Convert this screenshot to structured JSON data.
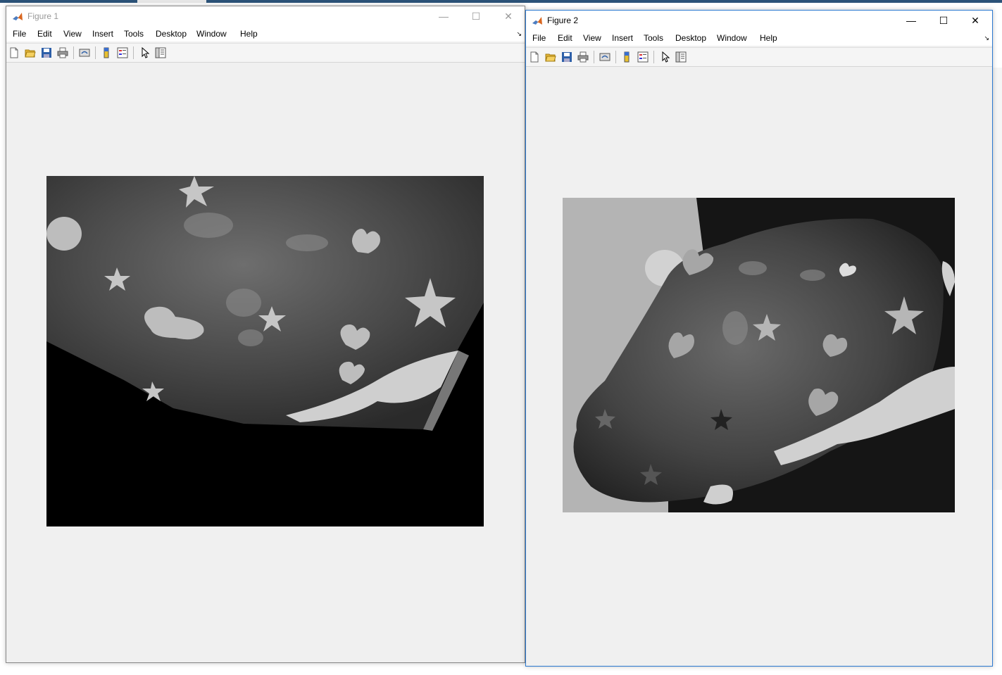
{
  "figures": [
    {
      "title": "Figure 1",
      "menu": [
        "File",
        "Edit",
        "View",
        "Insert",
        "Tools",
        "Desktop",
        "Window",
        "Help"
      ],
      "window_controls": {
        "minimize": "—",
        "maximize": "☐",
        "close": "✕"
      },
      "image_description_icon": "warped-grayscale-rock-image"
    },
    {
      "title": "Figure 2",
      "menu": [
        "File",
        "Edit",
        "View",
        "Insert",
        "Tools",
        "Desktop",
        "Window",
        "Help"
      ],
      "window_controls": {
        "minimize": "—",
        "maximize": "☐",
        "close": "✕"
      },
      "image_description_icon": "grayscale-rock-photo"
    }
  ],
  "toolbar_icons": [
    "new-figure-icon",
    "open-file-icon",
    "save-icon",
    "print-icon",
    "link-plot-icon",
    "colorbar-icon",
    "legend-icon",
    "edit-plot-icon",
    "property-inspector-icon"
  ],
  "colors": {
    "active_border": "#2b79d1",
    "figure_bg": "#f0f0f0"
  }
}
